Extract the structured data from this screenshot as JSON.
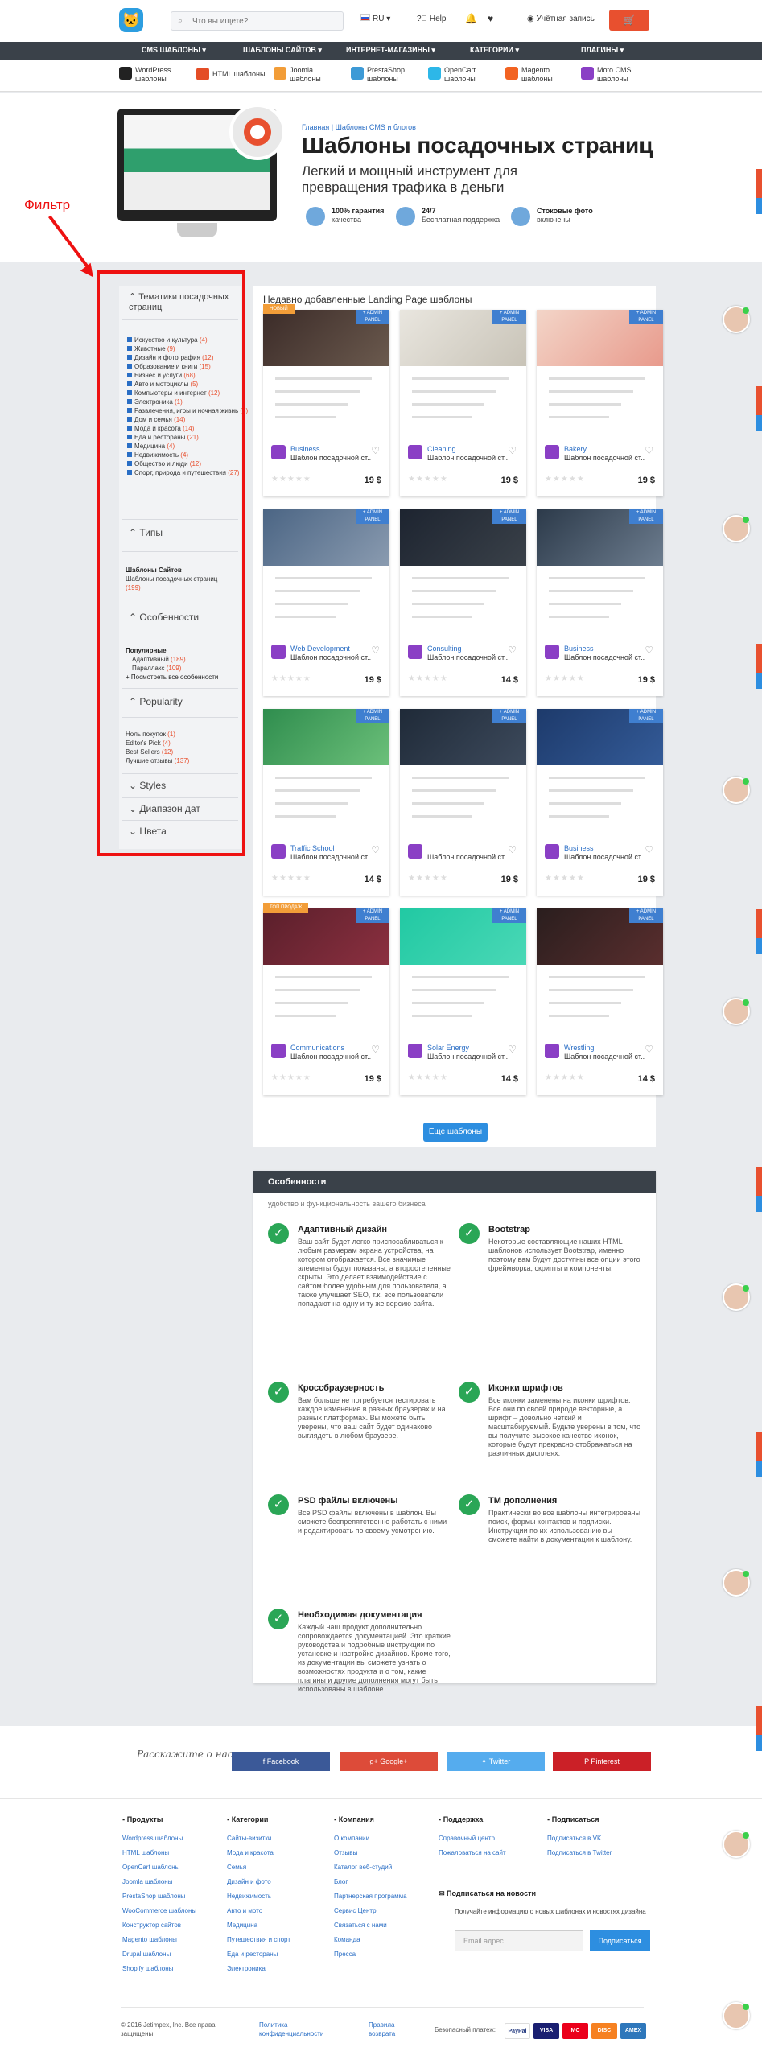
{
  "header": {
    "search_placeholder": "Что вы ищете?",
    "lang": "RU",
    "help": "Help",
    "account": "Учётная запись",
    "cart_icon": "cart-icon"
  },
  "nav": [
    "CMS ШАБЛОНЫ ▾",
    "ШАБЛОНЫ САЙТОВ ▾",
    "ИНТЕРНЕТ-МАГАЗИНЫ ▾",
    "КАТЕГОРИИ ▾",
    "ПЛАГИНЫ ▾"
  ],
  "cms": [
    {
      "name": "WordPress",
      "sub": "шаблоны",
      "color": "#222"
    },
    {
      "name": "HTML шаблоны",
      "sub": "",
      "color": "#e44d26"
    },
    {
      "name": "Joomla",
      "sub": "шаблоны",
      "color": "#f29d38"
    },
    {
      "name": "PrestaShop",
      "sub": "шаблоны",
      "color": "#3d9ad6"
    },
    {
      "name": "OpenCart",
      "sub": "шаблоны",
      "color": "#2db7e8"
    },
    {
      "name": "Magento",
      "sub": "шаблоны",
      "color": "#f26322"
    },
    {
      "name": "Moto CMS",
      "sub": "шаблоны",
      "color": "#8a3fc5"
    }
  ],
  "hero": {
    "crumbs": "Главная  |  Шаблоны CMS и блогов",
    "title": "Шаблоны посадочных страниц",
    "subtitle": "Легкий и мощный инструмент для превращения трафика в деньги",
    "features": [
      {
        "b": "100% гарантия",
        "t": "качества"
      },
      {
        "b": "24/7",
        "t": "Бесплатная поддержка"
      },
      {
        "b": "Стоковые фото",
        "t": "включены"
      }
    ]
  },
  "annotation": {
    "label": "Фильтр"
  },
  "sidebar": {
    "topics_title": "Тематики посадочных страниц",
    "topics": [
      [
        "Искусство и культура",
        "(4)"
      ],
      [
        "Животные",
        "(9)"
      ],
      [
        "Дизайн и фотография",
        "(12)"
      ],
      [
        "Образование и книги",
        "(15)"
      ],
      [
        "Бизнес и услуги",
        "(68)"
      ],
      [
        "Авто и мотоциклы",
        "(5)"
      ],
      [
        "Компьютеры и интернет",
        "(12)"
      ],
      [
        "Электроника",
        "(1)"
      ],
      [
        "Развлечения, игры и ночная жизнь",
        "(8)"
      ],
      [
        "Дом и семья",
        "(14)"
      ],
      [
        "Мода и красота",
        "(14)"
      ],
      [
        "Еда и рестораны",
        "(21)"
      ],
      [
        "Медицина",
        "(4)"
      ],
      [
        "Недвижимость",
        "(4)"
      ],
      [
        "Общество и люди",
        "(12)"
      ],
      [
        "Спорт, природа и путешествия",
        "(27)"
      ]
    ],
    "types_title": "Типы",
    "types_head": "Шаблоны Сайтов",
    "types_item": "Шаблоны посадочных страниц",
    "types_count": "(199)",
    "features_title": "Особенности",
    "popular": "Популярные",
    "feat_items": [
      [
        "Адаптивный",
        "(189)"
      ],
      [
        "Параллакс",
        "(109)"
      ]
    ],
    "feat_all": "+ Посмотреть все особенности",
    "pop_title": "Popularity",
    "pop_items": [
      [
        "Hoль покупок",
        "(1)"
      ],
      [
        "Editor's Pick",
        "(4)"
      ],
      [
        "Best Sellers",
        "(12)"
      ],
      [
        "Лучшие отзывы",
        "(137)"
      ]
    ],
    "styles": "Styles",
    "price": "Диапазон дат",
    "colors": "Цвета"
  },
  "panel_title": "Недавно добавленные Landing Page шаблоны",
  "ribbon_text": "+ ADMIN PANEL",
  "cards": [
    {
      "name": "Business",
      "desc": "Шаблон посадочной ст...",
      "price": "19 $",
      "tag": "НОВЫЙ",
      "c1": "#3b2b28",
      "c2": "#6b5a4e"
    },
    {
      "name": "Cleaning",
      "desc": "Шаблон посадочной ст...",
      "price": "19 $",
      "tag": "",
      "c1": "#e9e6df",
      "c2": "#c8c3b7"
    },
    {
      "name": "Bakery",
      "desc": "Шаблон посадочной ст...",
      "price": "19 $",
      "tag": "",
      "c1": "#f3d5c8",
      "c2": "#e89a8c"
    },
    {
      "name": "Web Development",
      "desc": "Шаблон посадочной ст...",
      "price": "19 $",
      "tag": "",
      "c1": "#4b6584",
      "c2": "#8a9bb0"
    },
    {
      "name": "Consulting",
      "desc": "Шаблон посадочной ст...",
      "price": "14 $",
      "tag": "",
      "c1": "#1d2430",
      "c2": "#3a4149"
    },
    {
      "name": "Business",
      "desc": "Шаблон посадочной ст...",
      "price": "19 $",
      "tag": "",
      "c1": "#2c3a4a",
      "c2": "#6d7d8f"
    },
    {
      "name": "Traffic School",
      "desc": "Шаблон посадочной ст...",
      "price": "14 $",
      "tag": "",
      "c1": "#2f8d4e",
      "c2": "#6cc07a"
    },
    {
      "name": "",
      "desc": "Шаблон посадочной ст...",
      "price": "19 $",
      "tag": "",
      "c1": "#1f2a38",
      "c2": "#3d4a5c"
    },
    {
      "name": "Business",
      "desc": "Шаблон посадочной ст...",
      "price": "19 $",
      "tag": "",
      "c1": "#1d3a6b",
      "c2": "#345b98"
    },
    {
      "name": "Communications",
      "desc": "Шаблон посадочной ст...",
      "price": "19 $",
      "tag": "ТОП ПРОДАЖ",
      "c1": "#5a1f2b",
      "c2": "#8c3040"
    },
    {
      "name": "Solar Energy",
      "desc": "Шаблон посадочной ст...",
      "price": "14 $",
      "tag": "",
      "c1": "#21c9a3",
      "c2": "#4ad8b6"
    },
    {
      "name": "Wrestling",
      "desc": "Шаблон посадочной ст...",
      "price": "14 $",
      "tag": "",
      "c1": "#2a1e1e",
      "c2": "#5a2e2e"
    }
  ],
  "more_button": "Еще шаблоны",
  "features_panel": {
    "title": "Особенности",
    "sub": "удобство и функциональность вашего бизнеса",
    "items": [
      {
        "t": "Адаптивный дизайн",
        "d": "Ваш сайт будет легко приспосабливаться к любым размерам экрана устройства, на котором отображается. Все значимые элементы будут показаны, а второстепенные скрыты. Это делает взаимодействие с сайтом более удобным для пользователя, а также улучшает SEO, т.к. все пользователи попадают на одну и ту же версию сайта."
      },
      {
        "t": "Bootstrap",
        "d": "Некоторые составляющие наших HTML шаблонов использует Bootstrap, именно поэтому вам будут доступны все опции этого фреймворка, скрипты и компоненты."
      },
      {
        "t": "Кроссбраузерность",
        "d": "Вам больше не потребуется тестировать каждое изменение в разных браузерах и на разных платформах. Вы можете быть уверены, что ваш сайт будет одинаково выглядеть в любом браузере."
      },
      {
        "t": "Иконки шрифтов",
        "d": "Все иконки заменены на иконки шрифтов. Все они по своей природе векторные, а шрифт – довольно четкий и масштабируемый. Будьте уверены в том, что вы получите высокое качество иконок, которые будут прекрасно отображаться на различных дисплеях."
      },
      {
        "t": "PSD файлы включены",
        "d": "Все PSD файлы включены в шаблон. Вы сможете беспрепятственно работать с ними и редактировать по своему усмотрению."
      },
      {
        "t": "TM дополнения",
        "d": "Практически во все шаблоны интегрированы поиск, формы контактов и подписки. Инструкции по их использованию вы сможете найти в документации к шаблону."
      },
      {
        "t": "Необходимая документация",
        "d": "Каждый наш продукт дополнительно сопровождается документацией. Это краткие руководства и подробные инструкции по установке и настройке дизайнов. Кроме того, из документации вы сможете узнать о возможностях продукта и о том, какие плагины и другие дополнения могут быть использованы в шаблоне."
      }
    ]
  },
  "social": {
    "hand": "Расскажите о нас",
    "buttons": [
      "Facebook",
      "Google+",
      "Twitter",
      "Pinterest"
    ]
  },
  "footer": {
    "cols": [
      {
        "h": "Продукты",
        "items": [
          "Wordpress шаблоны",
          "HTML шаблоны",
          "OpenCart шаблоны",
          "Joomla шаблоны",
          "PrestaShop шаблоны",
          "WooCommerce шаблоны",
          "Конструктор сайтов",
          "Magento шаблоны",
          "Drupal шаблоны",
          "Shopify шаблоны"
        ]
      },
      {
        "h": "Категории",
        "items": [
          "Сайты-визитки",
          "Мода и красота",
          "Семья",
          "Дизайн и фото",
          "Недвижимость",
          "Авто и мото",
          "Медицина",
          "Путешествия и спорт",
          "Еда и рестораны",
          "Электроника"
        ]
      },
      {
        "h": "Компания",
        "items": [
          "О компании",
          "Отзывы",
          "Каталог веб-студий",
          "Блог",
          "Партнерская программа",
          "Сервис Центр",
          "Связаться с нами",
          "Команда",
          "Пресса"
        ]
      },
      {
        "h": "Поддержка",
        "items": [
          "Справочный центр",
          "Пожаловаться на сайт"
        ]
      },
      {
        "h": "Подписаться",
        "items": [
          "Подписаться в VK",
          "Подписаться в Twitter"
        ]
      }
    ],
    "nl_title": "Подписаться на новости",
    "nl_text": "Получайте информацию о новых шаблонах и новостях дизайна",
    "nl_placeholder": "Email адрес",
    "nl_button": "Подписаться",
    "copy": "© 2016 Jetimpex, Inc. Все права защищены",
    "links": [
      "Политика конфиденциальности",
      "Правила возврата"
    ],
    "pay_label": "Безопасный платеж:",
    "pay": [
      "PayPal",
      "VISA",
      "MC",
      "DISC",
      "AMEX"
    ]
  }
}
